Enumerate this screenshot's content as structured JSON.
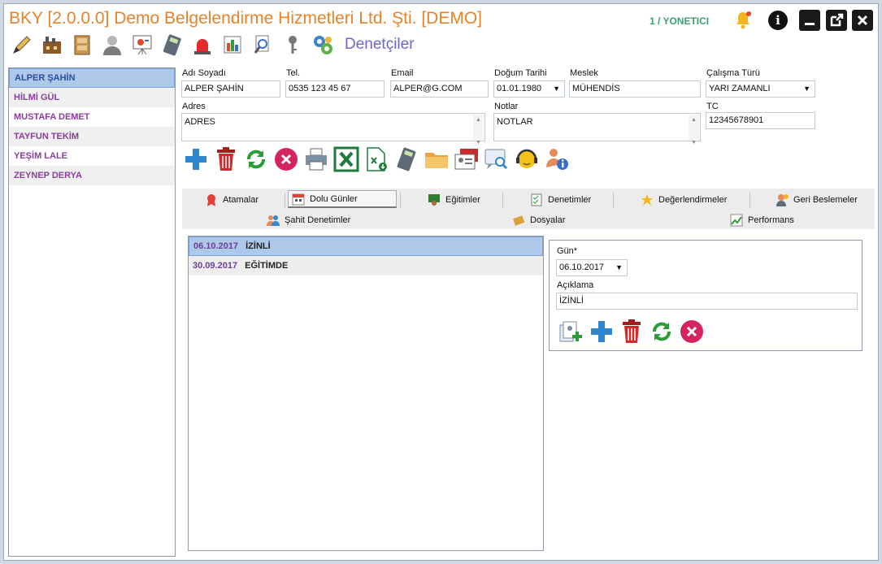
{
  "window": {
    "title": "BKY [2.0.0.0] Demo Belgelendirme Hizmetleri Ltd. Şti. [DEMO]",
    "user": "1 / YONETICI",
    "module_title": "Denetçiler"
  },
  "modules": [
    "edit-icon",
    "factory-icon",
    "cabinet-icon",
    "person-icon",
    "presentation-icon",
    "calculator-icon",
    "alarm-light-icon",
    "chart-icon",
    "search-doc-icon",
    "key-icon",
    "gears-icon"
  ],
  "auditors": [
    {
      "name": "ALPER ŞAHİN"
    },
    {
      "name": "HİLMİ GÜL"
    },
    {
      "name": "MUSTAFA DEMET"
    },
    {
      "name": "TAYFUN TEKİM"
    },
    {
      "name": "YEŞİM LALE"
    },
    {
      "name": "ZEYNEP DERYA"
    }
  ],
  "form": {
    "name": {
      "label": "Adı Soyadı",
      "value": "ALPER ŞAHİN"
    },
    "phone": {
      "label": "Tel.",
      "value": "0535 123 45 67"
    },
    "email": {
      "label": "Email",
      "value": "ALPER@G.COM"
    },
    "birth": {
      "label": "Doğum Tarihi",
      "value": "01.01.1980"
    },
    "job": {
      "label": "Meslek",
      "value": "MÜHENDİS"
    },
    "worktype": {
      "label": "Çalışma Türü",
      "value": "YARI ZAMANLI"
    },
    "address": {
      "label": "Adres",
      "value": "ADRES"
    },
    "notes": {
      "label": "Notlar",
      "value": "NOTLAR"
    },
    "tc": {
      "label": "TC",
      "value": "12345678901"
    }
  },
  "tabs": {
    "row1": [
      {
        "label": "Atamalar"
      },
      {
        "label": "Dolu Günler"
      },
      {
        "label": "Eğitimler"
      },
      {
        "label": "Denetimler"
      },
      {
        "label": "Değerlendirmeler"
      },
      {
        "label": "Geri Beslemeler"
      }
    ],
    "row2": [
      {
        "label": "Şahit Denetimler"
      },
      {
        "label": "Dosyalar"
      },
      {
        "label": "Performans"
      }
    ]
  },
  "days": [
    {
      "date": "06.10.2017",
      "desc": "İZİNLİ"
    },
    {
      "date": "30.09.2017",
      "desc": "EĞİTİMDE"
    }
  ],
  "detail": {
    "day_label": "Gün*",
    "day_value": "06.10.2017",
    "desc_label": "Açıklama",
    "desc_value": "İZİNLİ"
  },
  "colors": {
    "title": "#e8822a",
    "user": "#3d9e6f",
    "module_title": "#6a67c9",
    "list_text": "#8a3d9c",
    "selected_bg": "#aec8ea"
  }
}
